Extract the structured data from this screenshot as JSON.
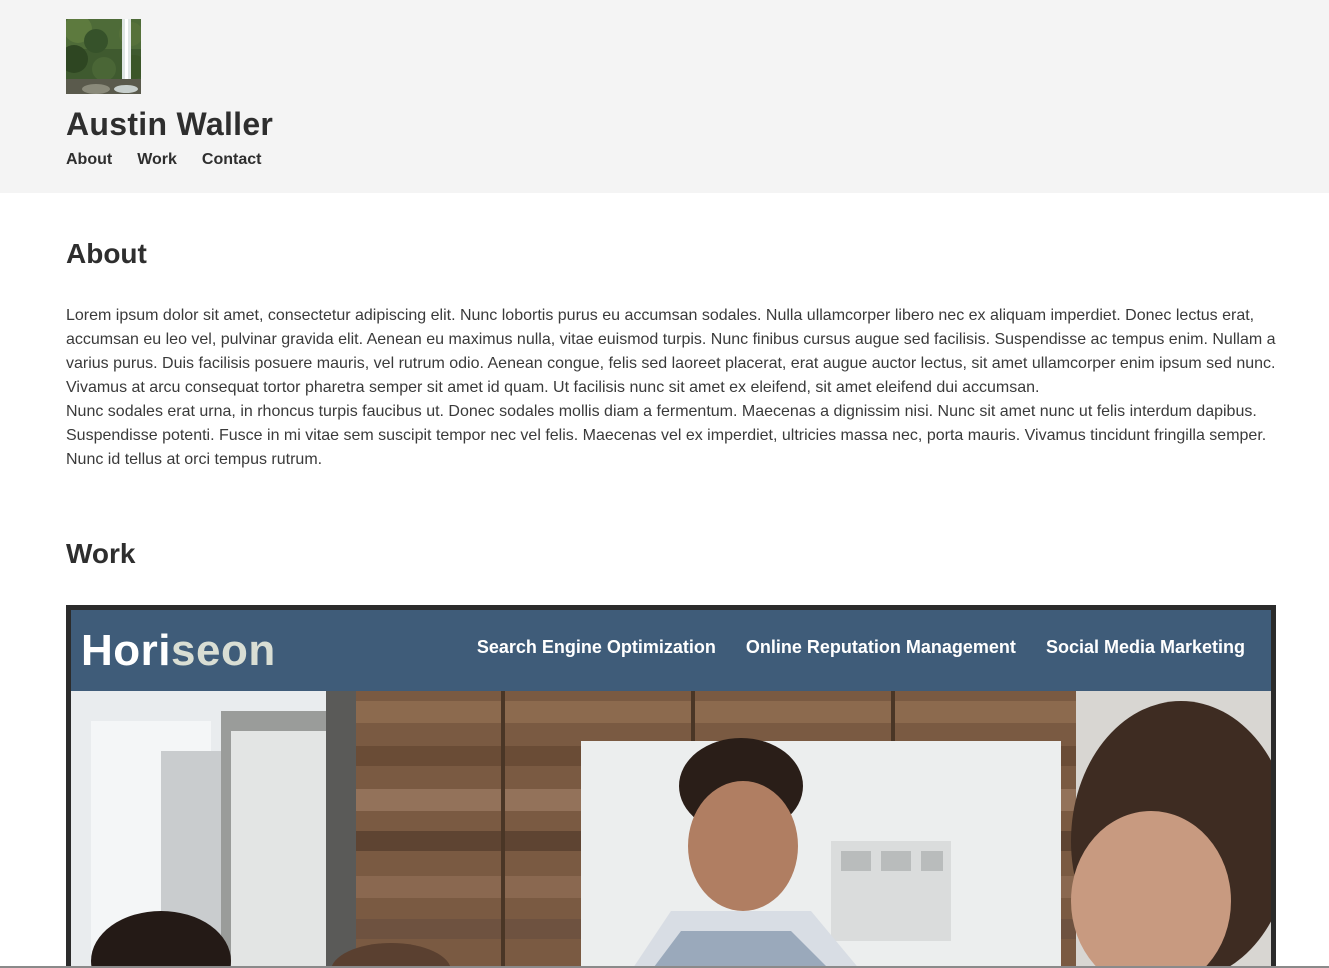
{
  "site": {
    "name": "Austin Waller",
    "avatar_icon": "waterfall-photo"
  },
  "nav": {
    "items": [
      {
        "label": "About"
      },
      {
        "label": "Work"
      },
      {
        "label": "Contact"
      }
    ]
  },
  "about": {
    "heading": "About",
    "paragraph1": "Lorem ipsum dolor sit amet, consectetur adipiscing elit. Nunc lobortis purus eu accumsan sodales. Nulla ullamcorper libero nec ex aliquam imperdiet. Donec lectus erat, accumsan eu leo vel, pulvinar gravida elit. Aenean eu maximus nulla, vitae euismod turpis. Nunc finibus cursus augue sed facilisis. Suspendisse ac tempus enim. Nullam a varius purus. Duis facilisis posuere mauris, vel rutrum odio. Aenean congue, felis sed laoreet placerat, erat augue auctor lectus, sit amet ullamcorper enim ipsum sed nunc. Vivamus at arcu consequat tortor pharetra semper sit amet id quam. Ut facilisis nunc sit amet ex eleifend, sit amet eleifend dui accumsan.",
    "paragraph2": "Nunc sodales erat urna, in rhoncus turpis faucibus ut. Donec sodales mollis diam a fermentum. Maecenas a dignissim nisi. Nunc sit amet nunc ut felis interdum dapibus. Suspendisse potenti. Fusce in mi vitae sem suscipit tempor nec vel felis. Maecenas vel ex imperdiet, ultricies massa nec, porta mauris. Vivamus tincidunt fringilla semper. Nunc id tellus at orci tempus rutrum."
  },
  "work": {
    "heading": "Work",
    "project": {
      "logo_part1": "Hori",
      "logo_part2": "seon",
      "nav": [
        {
          "label": "Search Engine Optimization"
        },
        {
          "label": "Online Reputation Management"
        },
        {
          "label": "Social Media Marketing"
        }
      ],
      "image_icon": "team-meeting-photo"
    }
  },
  "colors": {
    "header_bg": "#f4f4f4",
    "text": "#2e2e2e",
    "horiseon_bar": "#3f5c79",
    "card_border": "#2b2b2b"
  }
}
